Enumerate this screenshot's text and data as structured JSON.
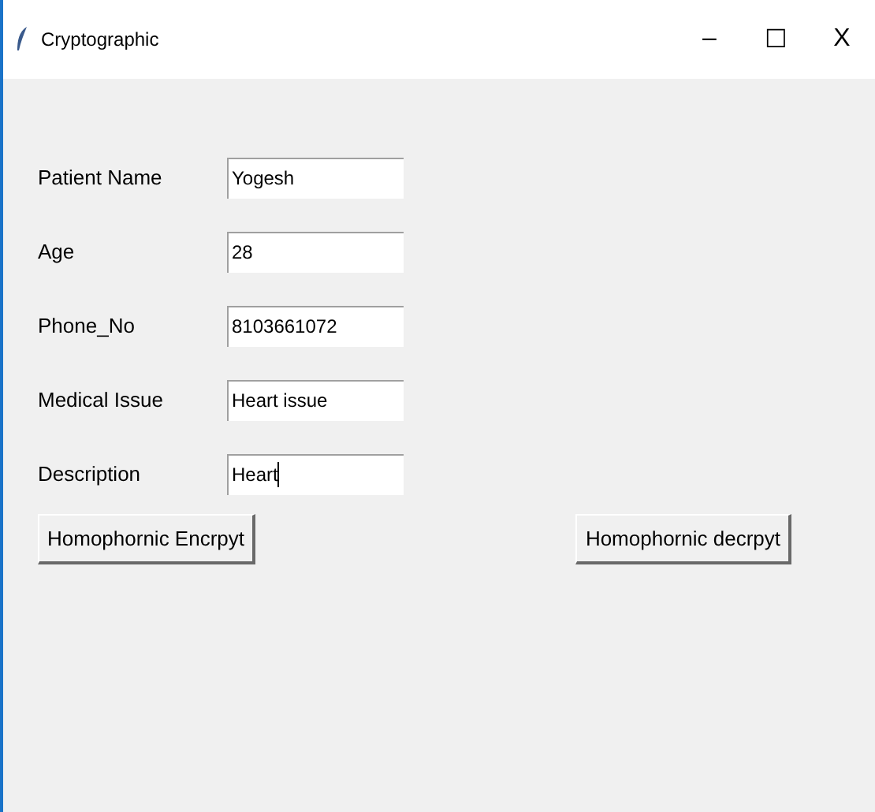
{
  "window": {
    "title": "Cryptographic",
    "controls": [
      "–",
      "☐",
      "X"
    ]
  },
  "fields": [
    {
      "label": "Patient Name",
      "value": "Yogesh",
      "focused": false
    },
    {
      "label": "Age",
      "value": "28",
      "focused": false
    },
    {
      "label": "Phone_No",
      "value": "8103661072",
      "focused": false
    },
    {
      "label": "Medical Issue",
      "value": "Heart issue",
      "focused": false
    },
    {
      "label": "Description",
      "value": "Heart",
      "focused": true
    }
  ],
  "buttons": [
    "Homophornic Encrpyt",
    "Homophornic decrpyt"
  ]
}
